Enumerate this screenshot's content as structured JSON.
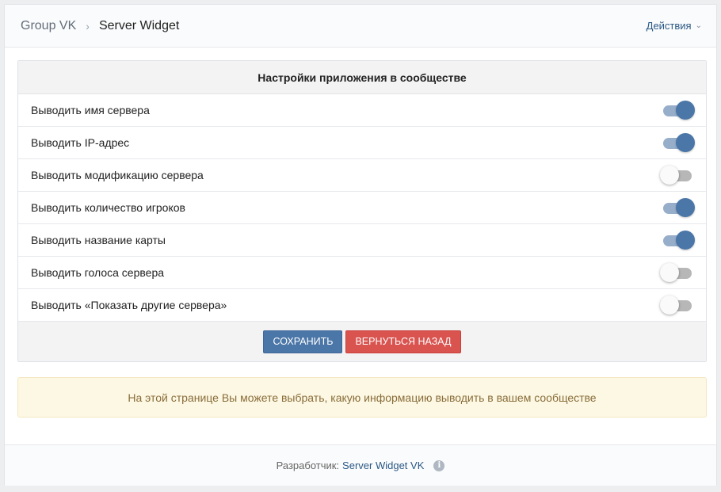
{
  "breadcrumb": {
    "root": "Group VK",
    "separator": "›",
    "current": "Server Widget"
  },
  "actions": {
    "label": "Действия",
    "chevron": "chevron-down-icon"
  },
  "settings": {
    "title": "Настройки приложения в сообществе",
    "rows": [
      {
        "label": "Выводить имя сервера",
        "on": true
      },
      {
        "label": "Выводить IP-адрес",
        "on": true
      },
      {
        "label": "Выводить модификацию сервера",
        "on": false
      },
      {
        "label": "Выводить количество игроков",
        "on": true
      },
      {
        "label": "Выводить название карты",
        "on": true
      },
      {
        "label": "Выводить голоса сервера",
        "on": false
      },
      {
        "label": "Выводить «Показать другие сервера»",
        "on": false
      }
    ],
    "save_label": "СОХРАНИТЬ",
    "back_label": "ВЕРНУТЬСЯ НАЗАД"
  },
  "notice": {
    "text": "На этой странице Вы можете выбрать, какую информацию выводить в вашем сообществе"
  },
  "footer": {
    "prefix": "Разработчик:",
    "link": "Server Widget VK",
    "info_icon": "info-icon"
  },
  "colors": {
    "accent": "#4a76a8",
    "danger": "#d9534f",
    "notice_bg": "#fcf8e3",
    "notice_text": "#8a6d3b",
    "link": "#2a5885"
  }
}
